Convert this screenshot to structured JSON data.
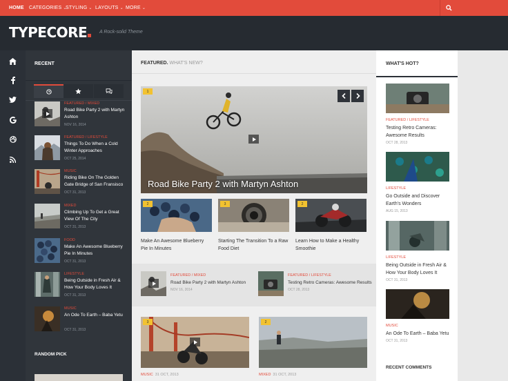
{
  "nav": {
    "home": "HOME",
    "categories": "CATEGORIES",
    "styling": "STYLING",
    "layouts": "LAYOUTS",
    "more": "MORE",
    "chevron": "⌄"
  },
  "brand": {
    "logo": "TYPECORE",
    "tagline": "A Rock-solid Theme"
  },
  "colors": {
    "accent": "#e24b3b",
    "header_bg": "#262b31",
    "sidebar_bg": "#30353b",
    "badge": "#f2c230"
  },
  "rail_icons": [
    "home-icon",
    "facebook-icon",
    "twitter-icon",
    "google-plus-icon",
    "dribbble-icon",
    "rss-icon"
  ],
  "sidebar": {
    "heading": "RECENT",
    "tabs": [
      "clock-icon",
      "star-icon",
      "comments-icon"
    ],
    "posts": [
      {
        "category": "FEATURED / MIXED",
        "title": "Road Bike Party 2 with Martyn Ashton",
        "date": "NOV 16, 2014"
      },
      {
        "category": "FEATURED / LIFESTYLE",
        "title": "Things To Do When a Cold Winter Approaches",
        "date": "OCT 25, 2014"
      },
      {
        "category": "MUSIC",
        "title": "Riding Bike On The Golden Gate Bridge of San Fransisco",
        "date": "OCT 31, 2013"
      },
      {
        "category": "MIXED",
        "title": "Climbing Up To Get a Great View Of The City",
        "date": "OCT 31, 2013"
      },
      {
        "category": "FOOD",
        "title": "Make An Awesome Blueberry Pie In Minutes",
        "date": "OCT 31, 2013"
      },
      {
        "category": "LIFESTYLE",
        "title": "Being Outside in Fresh Air & How Your Body Loves It",
        "date": "OCT 31, 2013"
      },
      {
        "category": "MUSIC",
        "title": "An Ode To Earth – Baba Yetu",
        "date": "OCT 31, 2013"
      }
    ],
    "random_heading": "RANDOM PICK"
  },
  "main": {
    "featured_label": "FEATURED.",
    "whats_new_label": "WHAT'S NEW?",
    "hero": {
      "title": "Road Bike Party 2 with Martyn Ashton",
      "comments": "1"
    },
    "cards": [
      {
        "title": "Make An Awesome Blueberry Pie In Minutes",
        "comments": "2"
      },
      {
        "title": "Starting The Transition To a Raw Food Diet",
        "comments": "3"
      },
      {
        "title": "Learn How to Make a Healthy Smoothie",
        "comments": "2"
      }
    ],
    "mini": [
      {
        "category": "FEATURED / MIXED",
        "title": "Road Bike Party 2 with Martyn Ashton",
        "date": "NOV 16, 2014"
      },
      {
        "category": "FEATURED / LIFESTYLE",
        "title": "Testing Retro Cameras: Awesome Results",
        "date": "OCT 28, 2013"
      }
    ],
    "bottom": [
      {
        "category": "MUSIC",
        "date": "31 OCT, 2013",
        "comments": "3"
      },
      {
        "category": "MIXED",
        "date": "31 OCT, 2013",
        "comments": "2"
      }
    ]
  },
  "right": {
    "heading": "WHAT'S HOT?",
    "items": [
      {
        "category": "FEATURED / LIFESTYLE",
        "title": "Testing Retro Cameras: Awesome Results",
        "date": "OCT 28, 2013"
      },
      {
        "category": "LIFESTYLE",
        "title": "Go Outside and Discover Earth's Wonders",
        "date": "AUG 15, 2013"
      },
      {
        "category": "LIFESTYLE",
        "title": "Being Outside in Fresh Air & How Your Body Loves It",
        "date": "OCT 31, 2013"
      },
      {
        "category": "MUSIC",
        "title": "An Ode To Earth – Baba Yetu",
        "date": "OCT 31, 2013"
      }
    ],
    "recent_comments": "RECENT COMMENTS"
  }
}
